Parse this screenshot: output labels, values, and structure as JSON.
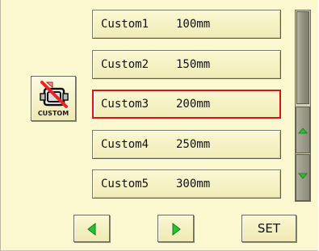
{
  "options": [
    {
      "name": "Custom1",
      "size": "100mm"
    },
    {
      "name": "Custom2",
      "size": "150mm"
    },
    {
      "name": "Custom3",
      "size": "200mm"
    },
    {
      "name": "Custom4",
      "size": "250mm"
    },
    {
      "name": "Custom5",
      "size": "300mm"
    }
  ],
  "selected_index": 2,
  "custom_icon": {
    "label": "CUSTOM",
    "icon": "hoop-frame-icon"
  },
  "scrollbar": {
    "up_icon": "arrow-up-icon",
    "down_icon": "arrow-down-icon"
  },
  "footer": {
    "prev_icon": "arrow-left-icon",
    "next_icon": "arrow-right-icon",
    "set_label": "SET"
  },
  "colors": {
    "background": "#fcf8d0",
    "selected_border": "#d8141a",
    "arrow_green": "#22c430"
  }
}
